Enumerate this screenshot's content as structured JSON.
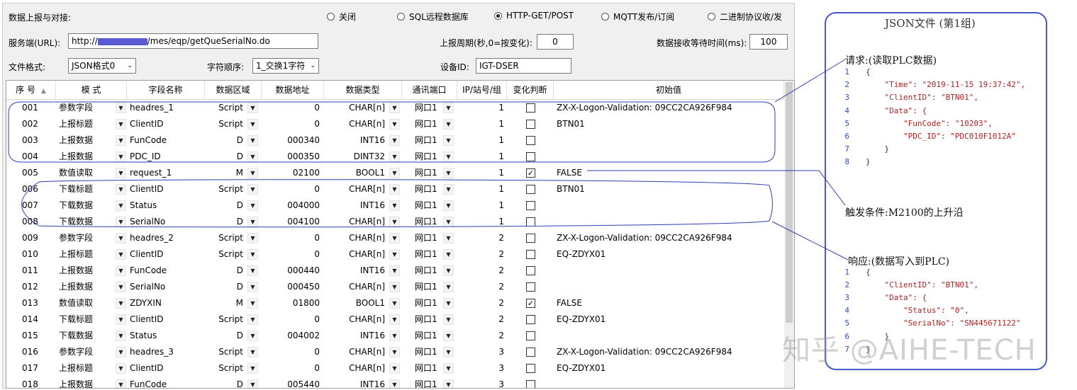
{
  "top": {
    "report_label": "数据上报与对接:",
    "modes": [
      {
        "label": "关闭",
        "selected": false
      },
      {
        "label": "SQL远程数据库",
        "selected": false
      },
      {
        "label": "HTTP-GET/POST",
        "selected": true
      },
      {
        "label": "MQTT发布/订阅",
        "selected": false
      },
      {
        "label": "二进制协议收/发",
        "selected": false
      }
    ],
    "server_label": "服务端(URL):",
    "server_prefix": "http://",
    "server_suffix": "/mes/eqp/getQueSerialNo.do",
    "period_label": "上报周期(秒,0=按变化):",
    "period_value": "0",
    "wait_label": "数据接收等待时间(ms):",
    "wait_value": "100",
    "format_label": "文件格式:",
    "format_value": "JSON格式0",
    "order_label": "字符顺序:",
    "order_value": "1_交换1字符",
    "device_label": "设备ID:",
    "device_value": "IGT-DSER"
  },
  "grid": {
    "headers": [
      "序 号",
      "模 式",
      "字段名称",
      "数据区域",
      "数据地址",
      "数据类型",
      "通讯端口",
      "IP/站号/组",
      "变化判断",
      "初始值"
    ],
    "rows": [
      {
        "no": "001",
        "mode": "参数字段",
        "field": "headres_1",
        "area": "Script",
        "addr": "0",
        "type": "CHAR[n]",
        "port": "网口1",
        "ip": "1",
        "chk": false,
        "init": "ZX-X-Logon-Validation: 09CC2CA926F984"
      },
      {
        "no": "002",
        "mode": "上报标题",
        "field": "ClientID",
        "area": "Script",
        "addr": "0",
        "type": "CHAR[n]",
        "port": "网口1",
        "ip": "1",
        "chk": false,
        "init": "BTN01"
      },
      {
        "no": "003",
        "mode": "上报数据",
        "field": "FunCode",
        "area": "D",
        "addr": "000340",
        "type": "INT16",
        "port": "网口1",
        "ip": "1",
        "chk": false,
        "init": ""
      },
      {
        "no": "004",
        "mode": "上报数据",
        "field": "PDC_ID",
        "area": "D",
        "addr": "000350",
        "type": "DINT32",
        "port": "网口1",
        "ip": "1",
        "chk": false,
        "init": ""
      },
      {
        "no": "005",
        "mode": "数值读取",
        "field": "request_1",
        "area": "M",
        "addr": "02100",
        "type": "BOOL1",
        "port": "网口1",
        "ip": "1",
        "chk": true,
        "init": "FALSE"
      },
      {
        "no": "006",
        "mode": "下载标题",
        "field": "ClientID",
        "area": "Script",
        "addr": "0",
        "type": "CHAR[n]",
        "port": "网口1",
        "ip": "1",
        "chk": false,
        "init": "BTN01"
      },
      {
        "no": "007",
        "mode": "下载数据",
        "field": "Status",
        "area": "D",
        "addr": "004000",
        "type": "INT16",
        "port": "网口1",
        "ip": "1",
        "chk": false,
        "init": ""
      },
      {
        "no": "008",
        "mode": "下载数据",
        "field": "SerialNo",
        "area": "D",
        "addr": "004100",
        "type": "CHAR[n]",
        "port": "网口1",
        "ip": "1",
        "chk": false,
        "init": ""
      },
      {
        "no": "009",
        "mode": "参数字段",
        "field": "headres_2",
        "area": "Script",
        "addr": "0",
        "type": "CHAR[n]",
        "port": "网口1",
        "ip": "2",
        "chk": false,
        "init": "ZX-X-Logon-Validation: 09CC2CA926F984"
      },
      {
        "no": "010",
        "mode": "上报标题",
        "field": "ClientID",
        "area": "Script",
        "addr": "0",
        "type": "CHAR[n]",
        "port": "网口1",
        "ip": "2",
        "chk": false,
        "init": "EQ-ZDYX01"
      },
      {
        "no": "011",
        "mode": "上报数据",
        "field": "FunCode",
        "area": "D",
        "addr": "000440",
        "type": "INT16",
        "port": "网口1",
        "ip": "2",
        "chk": false,
        "init": ""
      },
      {
        "no": "012",
        "mode": "上报数据",
        "field": "SerialNo",
        "area": "D",
        "addr": "000450",
        "type": "CHAR[n]",
        "port": "网口1",
        "ip": "2",
        "chk": false,
        "init": ""
      },
      {
        "no": "013",
        "mode": "数值读取",
        "field": "ZDYXIN",
        "area": "M",
        "addr": "01800",
        "type": "BOOL1",
        "port": "网口1",
        "ip": "2",
        "chk": true,
        "init": "FALSE"
      },
      {
        "no": "014",
        "mode": "下载标题",
        "field": "ClientID",
        "area": "Script",
        "addr": "0",
        "type": "CHAR[n]",
        "port": "网口1",
        "ip": "2",
        "chk": false,
        "init": "EQ-ZDYX01"
      },
      {
        "no": "015",
        "mode": "下载数据",
        "field": "Status",
        "area": "D",
        "addr": "004002",
        "type": "INT16",
        "port": "网口1",
        "ip": "2",
        "chk": false,
        "init": ""
      },
      {
        "no": "016",
        "mode": "参数字段",
        "field": "headres_3",
        "area": "Script",
        "addr": "0",
        "type": "CHAR[n]",
        "port": "网口1",
        "ip": "3",
        "chk": false,
        "init": "ZX-X-Logon-Validation: 09CC2CA926F984"
      },
      {
        "no": "017",
        "mode": "上报标题",
        "field": "ClientID",
        "area": "Script",
        "addr": "0",
        "type": "CHAR[n]",
        "port": "网口1",
        "ip": "3",
        "chk": false,
        "init": "EQ-ZDYX01"
      },
      {
        "no": "018",
        "mode": "上报数据",
        "field": "FunCode",
        "area": "D",
        "addr": "005440",
        "type": "INT16",
        "port": "网口1",
        "ip": "3",
        "chk": false,
        "init": ""
      }
    ]
  },
  "json_card": {
    "title": "JSON文件 (第1组)",
    "request_label": "请求:(读取PLC数据)",
    "request_lines": [
      "{",
      "    \"Time\": \"2019-11-15 19:37:42\",",
      "    \"ClientID\": \"BTN01\",",
      "    \"Data\": {",
      "        \"FunCode\": \"10203\",",
      "        \"PDC_ID\": \"PDC010F1012A\"",
      "    }",
      "}"
    ],
    "trigger_label": "触发条件:M2100的上升沿",
    "response_label": "响应:(数据写入到PLC)",
    "response_lines": [
      "{",
      "    \"ClientID\": \"BTN01\",",
      "    \"Data\": {",
      "        \"Status\": \"0\",",
      "        \"SerialNo\": \"SN445671122\"",
      "    }",
      "}"
    ],
    "line_numbers_req": [
      "1",
      "2",
      "3",
      "4",
      "5",
      "6",
      "7",
      "8"
    ],
    "line_numbers_resp": [
      "1",
      "2",
      "3",
      "4",
      "5",
      "6",
      "7"
    ]
  },
  "watermark": "知乎 @AIHE-TECH",
  "colors": {
    "annotation": "#2f3fb5",
    "card_border": "#4a5acb",
    "line_number": "#2b4fc7",
    "string": "#b22222"
  }
}
